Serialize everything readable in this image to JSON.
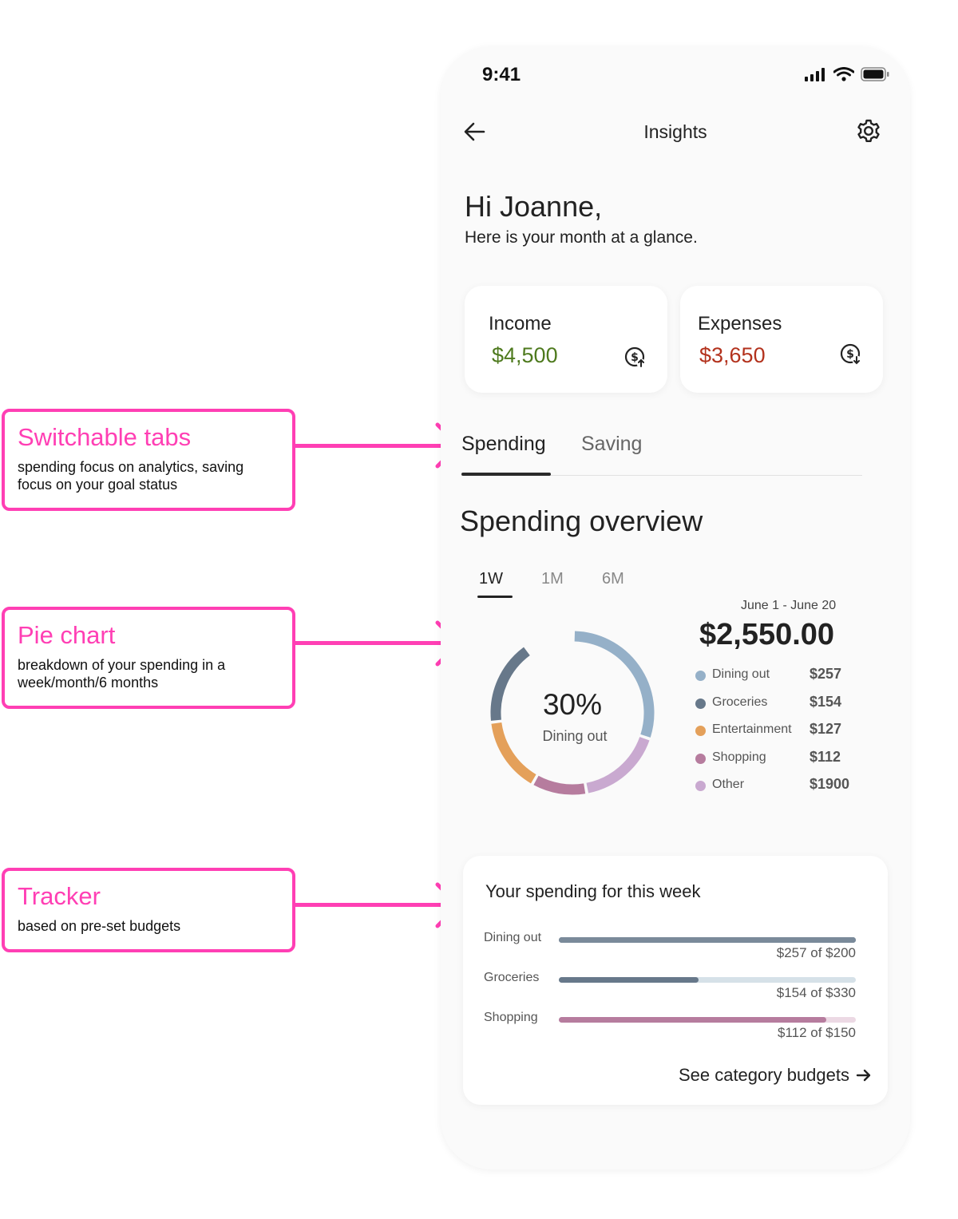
{
  "annotations": [
    {
      "title": "Switchable tabs",
      "desc": "spending focus on analytics, saving focus on your goal status"
    },
    {
      "title": "Pie chart",
      "desc": "breakdown of your spending in a week/month/6 months"
    },
    {
      "title": "Tracker",
      "desc": "based on pre-set budgets"
    }
  ],
  "status": {
    "time": "9:41"
  },
  "nav": {
    "title": "Insights",
    "back_icon": "back-arrow-icon",
    "settings_icon": "gear-icon"
  },
  "greeting": {
    "title": "Hi Joanne,",
    "subtitle": "Here is your month at a glance."
  },
  "summary": {
    "income": {
      "label": "Income",
      "value": "$4,500",
      "color": "#4e7a1e"
    },
    "expenses": {
      "label": "Expenses",
      "value": "$3,650",
      "color": "#b3321d"
    }
  },
  "tabs": [
    {
      "label": "Spending",
      "active": true
    },
    {
      "label": "Saving",
      "active": false
    }
  ],
  "overview": {
    "title": "Spending overview",
    "periods": [
      {
        "label": "1W",
        "active": true
      },
      {
        "label": "1M",
        "active": false
      },
      {
        "label": "6M",
        "active": false
      }
    ],
    "range": "June 1 - June 20",
    "total": "$2,550.00",
    "center_pct": "30%",
    "center_label": "Dining out"
  },
  "chart_data": {
    "type": "pie",
    "categories": [
      "Dining out",
      "Groceries",
      "Entertainment",
      "Shopping",
      "Other"
    ],
    "labels": [
      "$257",
      "$154",
      "$127",
      "$112",
      "$1900"
    ],
    "slice_fractions": [
      0.3,
      0.17,
      0.15,
      0.11,
      0.17
    ],
    "colors": [
      "#95b0c8",
      "#67788a",
      "#e4a05a",
      "#b67c9e",
      "#c9a9d0"
    ]
  },
  "week": {
    "title": "Your spending for this week",
    "rows": [
      {
        "label": "Dining out",
        "amount": "$257 of  $200",
        "progress": 1.0,
        "fill": "#7a8a9a",
        "track": "#7a8a9a"
      },
      {
        "label": "Groceries",
        "amount": "$154 of  $330",
        "progress": 0.47,
        "fill": "#67788a",
        "track": "#d6e1e8"
      },
      {
        "label": "Shopping",
        "amount": "$112 of  $150",
        "progress": 0.9,
        "fill": "#b67c9e",
        "track": "#ecd9e4"
      }
    ],
    "link": "See category budgets"
  }
}
